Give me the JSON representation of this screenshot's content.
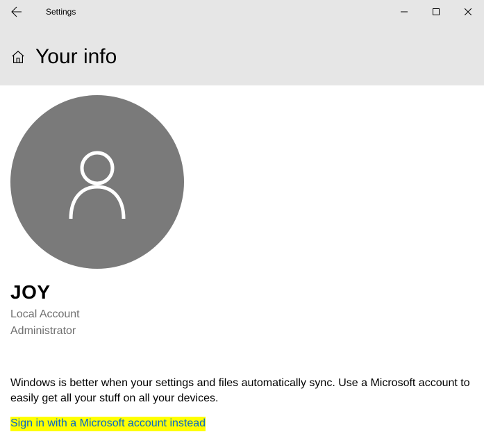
{
  "window": {
    "title": "Settings"
  },
  "header": {
    "title": "Your info"
  },
  "profile": {
    "username": "JOY",
    "account_type": "Local Account",
    "role": "Administrator"
  },
  "description": "Windows is better when your settings and files automatically sync. Use a Microsoft account to easily get all your stuff on all your devices.",
  "signin_link": "Sign in with a Microsoft account instead"
}
